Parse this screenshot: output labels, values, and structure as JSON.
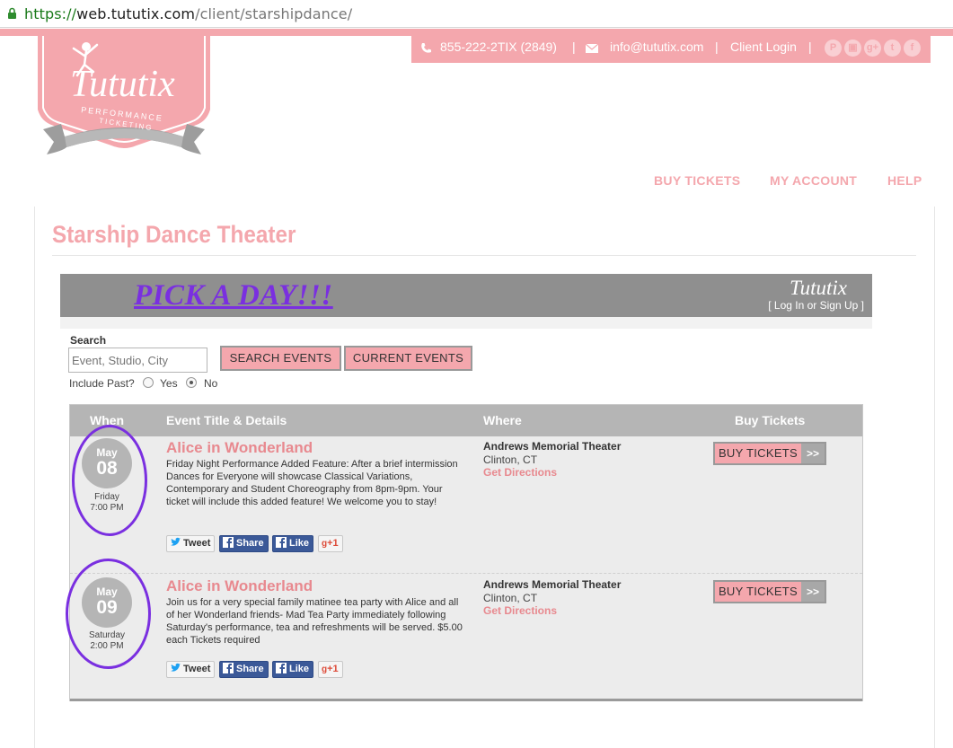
{
  "browser": {
    "url_protocol": "https://",
    "url_host": "web.tututix.com",
    "url_path": "/client/starshipdance/"
  },
  "topbar": {
    "phone": "855-222-2TIX (2849)",
    "email": "info@tututix.com",
    "client_login": "Client Login",
    "separator": "|"
  },
  "logo": {
    "name": "Tututix",
    "banner_line1": "PERFORMANCE",
    "banner_line2": "TICKETING"
  },
  "nav": {
    "buy_tickets": "BUY TICKETS",
    "my_account": "MY ACCOUNT",
    "help": "HELP"
  },
  "page": {
    "title": "Starship Dance Theater"
  },
  "banner": {
    "headline": "PICK A DAY!!!",
    "logo_text": "Tututix",
    "login_link": "[ Log In or Sign Up ]"
  },
  "search": {
    "label": "Search",
    "placeholder": "Event, Studio, City",
    "search_button": "SEARCH EVENTS",
    "current_button": "CURRENT EVENTS",
    "include_past_label": "Include Past?",
    "yes_label": "Yes",
    "no_label": "No",
    "include_past_selected": "No"
  },
  "table": {
    "headers": {
      "when": "When",
      "event": "Event Title & Details",
      "where": "Where",
      "buy": "Buy Tickets"
    }
  },
  "events": [
    {
      "month": "May",
      "day": "08",
      "weekday": "Friday",
      "time": "7:00 PM",
      "title": "Alice in Wonderland",
      "description": "Friday Night Performance Added Feature: After a brief intermission Dances for Everyone will showcase Classical Variations, Contemporary and Student Choreography from 8pm-9pm. Your ticket will include this added feature! We welcome you to stay!",
      "venue": "Andrews Memorial Theater",
      "city": "Clinton, CT",
      "directions": "Get Directions",
      "buy_label": "BUY TICKETS",
      "buy_arrow": ">>",
      "tweet": "Tweet",
      "share": "Share",
      "like": "Like",
      "gplus": "+1"
    },
    {
      "month": "May",
      "day": "09",
      "weekday": "Saturday",
      "time": "2:00 PM",
      "title": "Alice in Wonderland",
      "description": "Join us for a very special family matinee tea party with Alice and all of her Wonderland friends- Mad Tea Party immediately following Saturday's performance, tea and refreshments will be served. $5.00 each Tickets required",
      "venue": "Andrews Memorial Theater",
      "city": "Clinton, CT",
      "directions": "Get Directions",
      "buy_label": "BUY TICKETS",
      "buy_arrow": ">>",
      "tweet": "Tweet",
      "share": "Share",
      "like": "Like",
      "gplus": "+1"
    }
  ],
  "colors": {
    "brand_pink": "#f4a7ad",
    "link_pink": "#e8898f",
    "annotation_purple": "#7a2fe0",
    "header_gray": "#b5b5b5"
  }
}
